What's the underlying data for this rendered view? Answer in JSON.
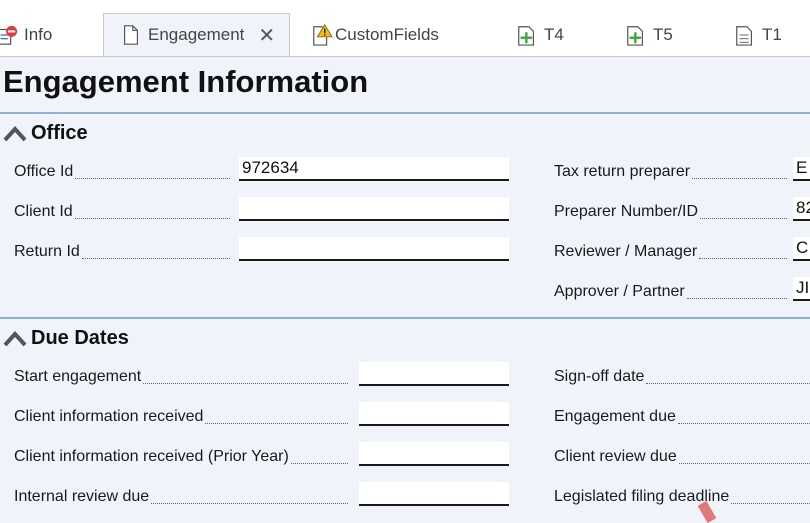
{
  "tabs": [
    {
      "label": "Info",
      "icon": "info-stop-icon"
    },
    {
      "label": "Engagement",
      "icon": "document-icon",
      "active": true
    },
    {
      "label": "CustomFields",
      "icon": "document-warning-icon"
    },
    {
      "label": "T4",
      "icon": "document-add-icon"
    },
    {
      "label": "T5",
      "icon": "document-add-icon"
    },
    {
      "label": "T1",
      "icon": "document-icon"
    }
  ],
  "page_title": "Engagement Information",
  "office": {
    "title": "Office",
    "left": [
      {
        "label": "Office Id",
        "value": "972634"
      },
      {
        "label": "Client Id",
        "value": ""
      },
      {
        "label": "Return Id",
        "value": ""
      }
    ],
    "right": [
      {
        "label": "Tax return preparer",
        "value": "E"
      },
      {
        "label": "Preparer Number/ID",
        "value": "82"
      },
      {
        "label": "Reviewer / Manager",
        "value": "C"
      },
      {
        "label": "Approver / Partner",
        "value": "JI"
      }
    ]
  },
  "due_dates": {
    "title": "Due Dates",
    "left": [
      {
        "label": "Start engagement",
        "value": ""
      },
      {
        "label": "Client information received",
        "value": ""
      },
      {
        "label": "Client information received (Prior Year)",
        "value": ""
      },
      {
        "label": "Internal review due",
        "value": ""
      }
    ],
    "right": [
      {
        "label": "Sign-off date",
        "value": ""
      },
      {
        "label": "Engagement due",
        "value": ""
      },
      {
        "label": "Client review due",
        "value": ""
      },
      {
        "label": "Legislated filing deadline",
        "value": ""
      }
    ]
  },
  "colors": {
    "separator": "#8fb0d8",
    "background": "#f0f4fa",
    "add_icon": "#3aa83a",
    "warning_icon": "#f2c01e",
    "stop_icon": "#e03a3a"
  }
}
